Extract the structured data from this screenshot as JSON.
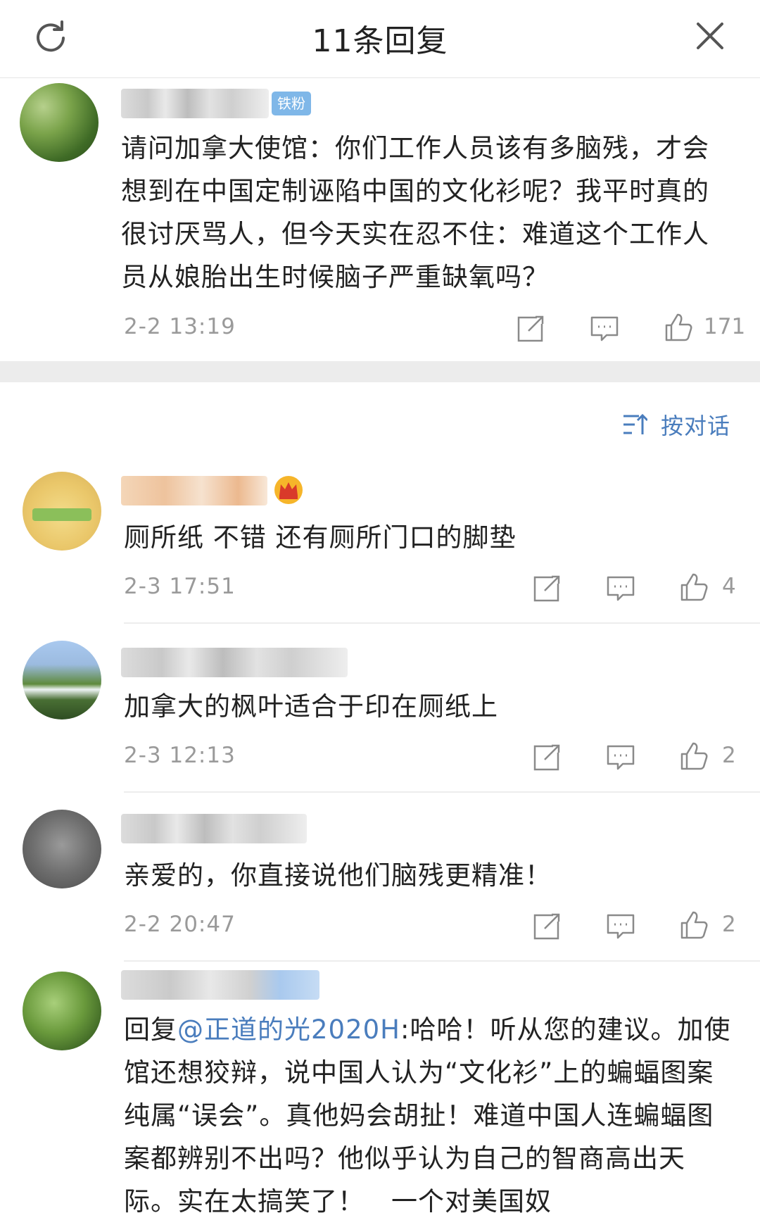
{
  "header": {
    "title": "11条回复",
    "refresh_icon": "refresh-icon",
    "close_icon": "close-icon"
  },
  "main_comment": {
    "badge": "铁粉",
    "text": "请问加拿大使馆：你们工作人员该有多脑残，才会想到在中国定制诬陷中国的文化衫呢？我平时真的很讨厌骂人，但今天实在忍不住：难道这个工作人员从娘胎出生时候脑子严重缺氧吗？",
    "time": "2-2 13:19",
    "likes": "171"
  },
  "sort": {
    "label": "按对话",
    "icon": "sort-icon"
  },
  "replies": [
    {
      "text": "厕所纸 不错 还有厕所门口的脚垫",
      "time": "2-3 17:51",
      "likes": "4"
    },
    {
      "text": "加拿大的枫叶适合于印在厕纸上",
      "time": "2-3 12:13",
      "likes": "2"
    },
    {
      "text": "亲爱的，你直接说他们脑残更精准！",
      "time": "2-2 20:47",
      "likes": "2"
    },
    {
      "prefix": "回复",
      "mention": "@正道的光2020H",
      "text": ":哈哈！听从您的建议。加使馆还想狡辩，说中国人认为“文化衫”上的蝙蝠图案纯属“误会”。真他妈会胡扯！难道中国人连蝙蝠图案都辨别不出吗？他似乎认为自己的智商高出天际。实在太搞笑了！　一个对美国奴"
    }
  ],
  "colors": {
    "accent": "#4a7dbd",
    "badge": "#7fb7e8",
    "secondary_text": "#9a9a9a",
    "separator": "#ececec"
  }
}
